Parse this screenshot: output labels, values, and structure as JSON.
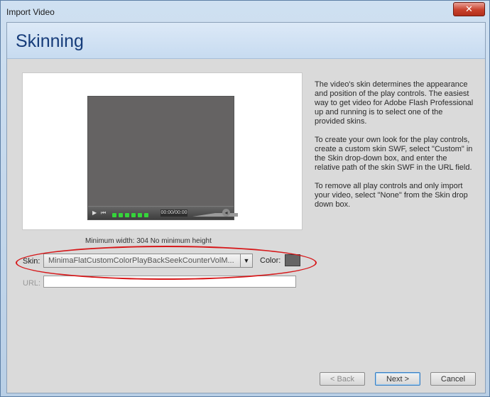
{
  "window": {
    "title": "Import Video",
    "close_glyph": "✕"
  },
  "header": {
    "title": "Skinning"
  },
  "preview": {
    "counter": "00:00/00:00",
    "dimensions": "Minimum width: 304    No minimum height",
    "seek_dot_count": 6
  },
  "description": {
    "p1": "The video's skin determines the appearance and position of the play controls. The easiest way to get video for Adobe Flash Professional up and running is to select one of the provided skins.",
    "p2": "To create your own look for the play controls, create a custom skin SWF, select \"Custom\" in the Skin drop-down box, and enter the relative path of the skin SWF in the URL field.",
    "p3": "To remove all play controls and only import your video, select \"None\" from the Skin drop down box."
  },
  "form": {
    "skin_label": "Skin:",
    "skin_value": "MinimaFlatCustomColorPlayBackSeekCounterVolM...",
    "color_label": "Color:",
    "color_value": "#666565",
    "url_label": "URL:",
    "url_value": ""
  },
  "buttons": {
    "back": "< Back",
    "next": "Next >",
    "cancel": "Cancel"
  },
  "icons": {
    "play": "play-icon",
    "rewind": "rewind-icon",
    "speaker": "speaker-icon",
    "dropdown": "chevron-down-icon"
  },
  "colors": {
    "header_title": "#163c7a",
    "annotation": "#d6181a",
    "seek_fill": "#35d43a"
  }
}
